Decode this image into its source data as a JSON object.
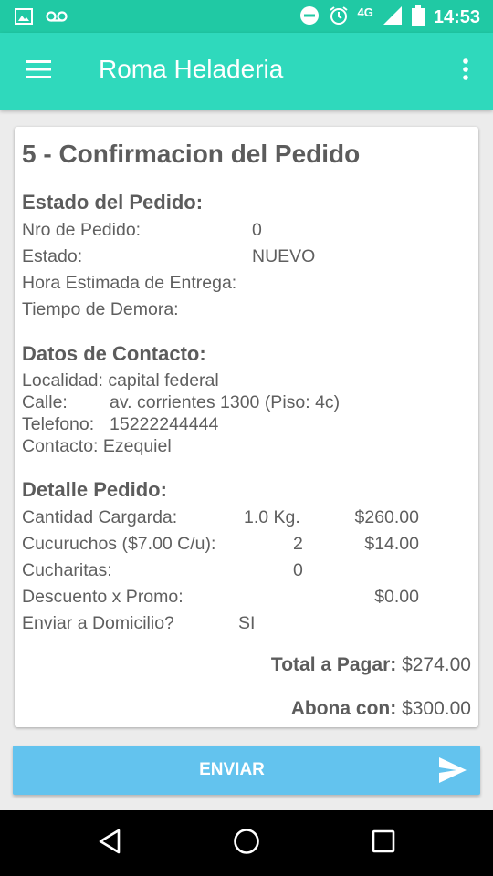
{
  "status_bar": {
    "time": "14:53",
    "network": "4G",
    "icons": [
      "image-icon",
      "voicemail-icon",
      "do-not-disturb-icon",
      "alarm-icon",
      "signal-icon",
      "battery-icon"
    ]
  },
  "toolbar": {
    "title": "Roma Heladeria",
    "menu_icon": "hamburger-menu-icon",
    "overflow_icon": "more-vert-icon"
  },
  "card": {
    "title": "5 - Confirmacion del Pedido",
    "estado": {
      "heading": "Estado del Pedido:",
      "nro_label": "Nro de Pedido:",
      "nro_value": "0",
      "estado_label": "Estado:",
      "estado_value": "NUEVO",
      "hora_label": "Hora Estimada de Entrega:",
      "demora_label": "Tiempo de Demora:"
    },
    "contacto": {
      "heading": "Datos de Contacto:",
      "localidad": "Localidad: capital federal",
      "calle_label": "Calle:",
      "calle_value": "av. corrientes 1300 (Piso: 4c)",
      "telefono_label": "Telefono:",
      "telefono_value": "15222244444",
      "contacto": "Contacto: Ezequiel"
    },
    "detalle": {
      "heading": "Detalle Pedido:",
      "cantidad_label": "Cantidad Cargarda:",
      "cantidad_qty": "1.0 Kg.",
      "cantidad_price": "$260.00",
      "cucuruchos_label": "Cucuruchos ($7.00 C/u):",
      "cucuruchos_qty": "2",
      "cucuruchos_price": "$14.00",
      "cucharitas_label": "Cucharitas:",
      "cucharitas_qty": "0",
      "descuento_label": "Descuento x Promo:",
      "descuento_price": "$0.00",
      "domicilio_label": "Enviar a Domicilio?",
      "domicilio_value": "SI"
    },
    "total_label": "Total a Pagar:",
    "total_value": "$274.00",
    "abona_label": "Abona con:",
    "abona_value": "$300.00"
  },
  "send_button": {
    "label": "ENVIAR",
    "icon": "send-icon"
  },
  "nav_bar": {
    "icons": [
      "back-icon",
      "home-icon",
      "recents-icon"
    ]
  },
  "colors": {
    "status_bar": "#20c9a4",
    "toolbar": "#2fd9bc",
    "send_button": "#63c3ee",
    "text": "#5f5f5f"
  }
}
